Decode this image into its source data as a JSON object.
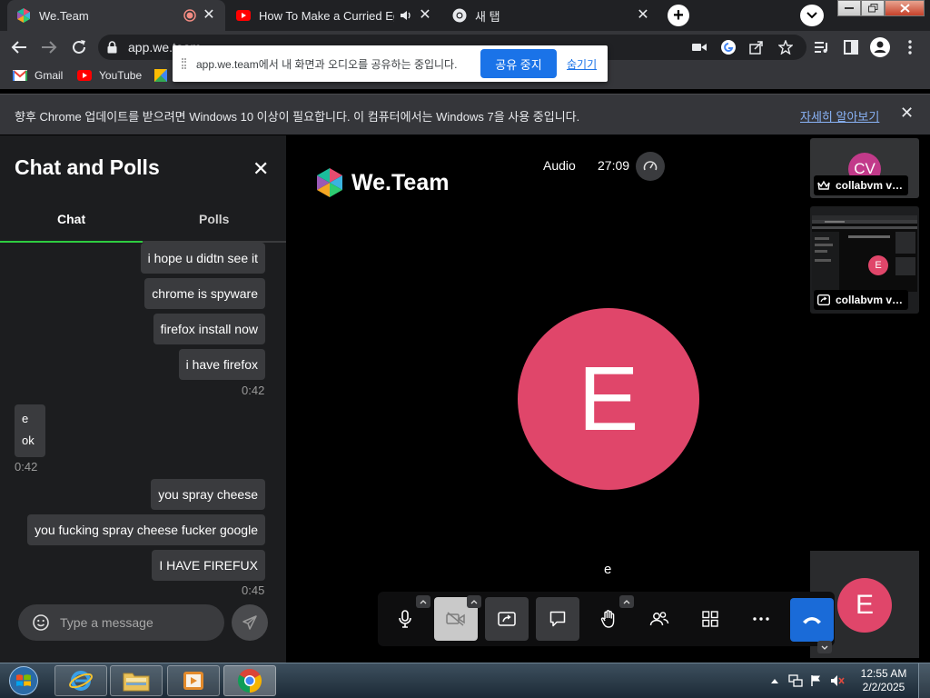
{
  "browser": {
    "tabs": [
      {
        "title": "We.Team",
        "icon": "weteam-logo-icon",
        "active": true
      },
      {
        "title": "How To Make a Curried Egg",
        "icon": "youtube-icon",
        "active": false
      },
      {
        "title": "새 탭",
        "icon": "chrome-icon",
        "active": false
      }
    ],
    "url": "app.we.team",
    "bookmarks": [
      {
        "label": "Gmail",
        "icon": "gmail-icon"
      },
      {
        "label": "YouTube",
        "icon": "youtube-icon"
      }
    ],
    "share_bar": {
      "message": "app.we.team에서 내 화면과 오디오를 공유하는 중입니다.",
      "stop_label": "공유 중지",
      "hide_label": "숨기기"
    },
    "info_bar": {
      "message": "향후 Chrome 업데이트를 받으려면 Windows 10 이상이 필요합니다. 이 컴퓨터에서는 Windows 7을 사용 중입니다.",
      "link": "자세히 알아보기"
    }
  },
  "chat_panel": {
    "title": "Chat and Polls",
    "tabs": [
      "Chat",
      "Polls"
    ],
    "messages_out_1": [
      {
        "text": "i hope u didtn see it"
      },
      {
        "text": "chrome is spyware"
      },
      {
        "text": "firefox install now"
      },
      {
        "text": "i have firefox"
      }
    ],
    "time_1": "0:42",
    "messages_in": [
      "e",
      "ok"
    ],
    "time_2": "0:42",
    "messages_out_2": [
      {
        "text": "you spray cheese"
      },
      {
        "text": "you fucking spray cheese fucker google"
      },
      {
        "text": "I HAVE FIREFUX"
      }
    ],
    "time_3": "0:45",
    "input_placeholder": "Type a message"
  },
  "meeting": {
    "brand": "We.Team",
    "audio_label": "Audio",
    "timer": "27:09",
    "main_avatar_initial": "E",
    "speaker_name": "e",
    "participants": [
      {
        "initials": "CV",
        "label": "collabvm v…",
        "role": "host"
      },
      {
        "initials": "E",
        "label": "collabvm v…",
        "role": "screen-share"
      }
    ],
    "self_initial": "E"
  },
  "taskbar": {
    "time": "12:55 AM",
    "date": "2/2/2025"
  },
  "colors": {
    "accent_green": "#2ecc40",
    "avatar_pink": "#e0466a",
    "leave_blue": "#1a6bd8",
    "share_blue": "#1a73e8"
  }
}
